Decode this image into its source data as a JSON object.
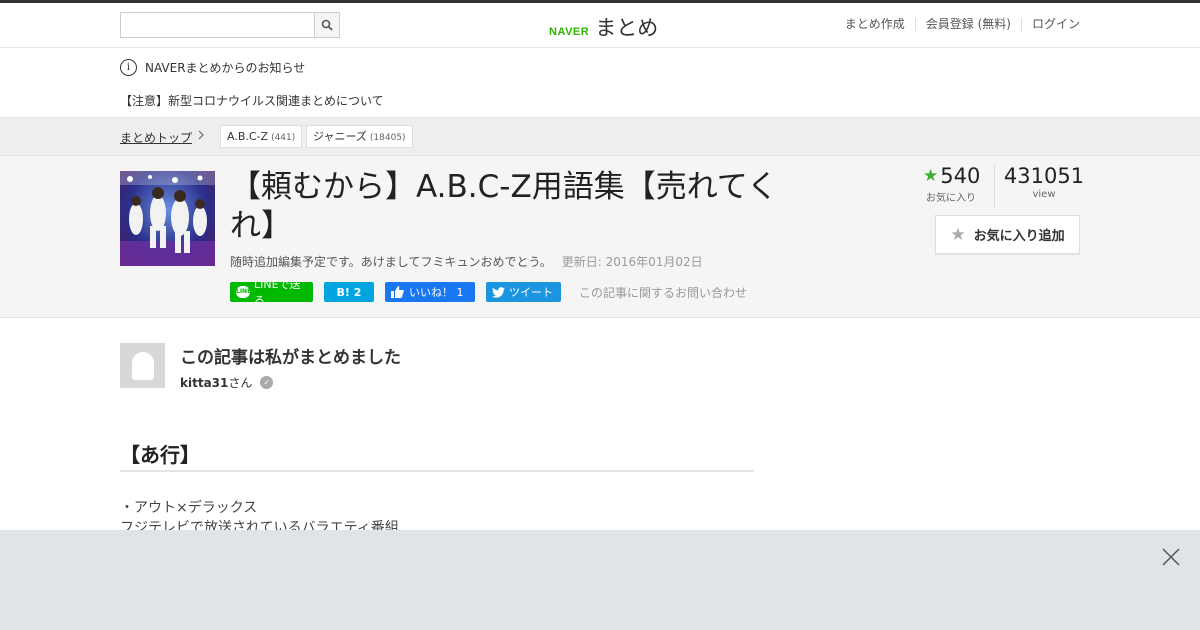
{
  "header": {
    "search_placeholder": "",
    "logo_brand": "NAVER",
    "logo_text": "まとめ",
    "nav": [
      "まとめ作成",
      "会員登録 (無料)",
      "ログイン"
    ]
  },
  "notice": {
    "info_symbol": "i",
    "title": "NAVERまとめからのお知らせ",
    "item": "【注意】新型コロナウイルス関連まとめについて"
  },
  "breadcrumb": {
    "home": "まとめトップ",
    "tags": [
      {
        "label": "A.B.C-Z",
        "count": "(441)"
      },
      {
        "label": "ジャニーズ",
        "count": "(18405)"
      }
    ]
  },
  "article": {
    "title": "【頼むから】A.B.C-Z用語集【売れてくれ】",
    "description": "随時追加編集予定です。あけましてフミキュンおめでとう。",
    "updated": "更新日: 2016年01月02日",
    "favorites_count": "540",
    "favorites_label": "お気に入り",
    "views_count": "431051",
    "views_label": "view",
    "fav_button": "お気に入り追加"
  },
  "share": {
    "line": "LINEで送る",
    "hatena": "B! 2",
    "facebook": "いいね！ 1",
    "twitter": "ツイート",
    "inquiry": "この記事に関するお問い合わせ"
  },
  "author": {
    "heading": "この記事は私がまとめました",
    "username": "kitta31",
    "suffix": "さん"
  },
  "content": {
    "section_title": "【あ行】",
    "line1": "・アウト×デラックス",
    "line2": "フジテレビで放送されているバラエティ番組"
  },
  "colors": {
    "brand_green": "#2db400",
    "line_green": "#00b900",
    "hatena_blue": "#00a4de",
    "facebook_blue": "#1877f2",
    "twitter_blue": "#1b95e0",
    "star_green": "#3cb034"
  }
}
